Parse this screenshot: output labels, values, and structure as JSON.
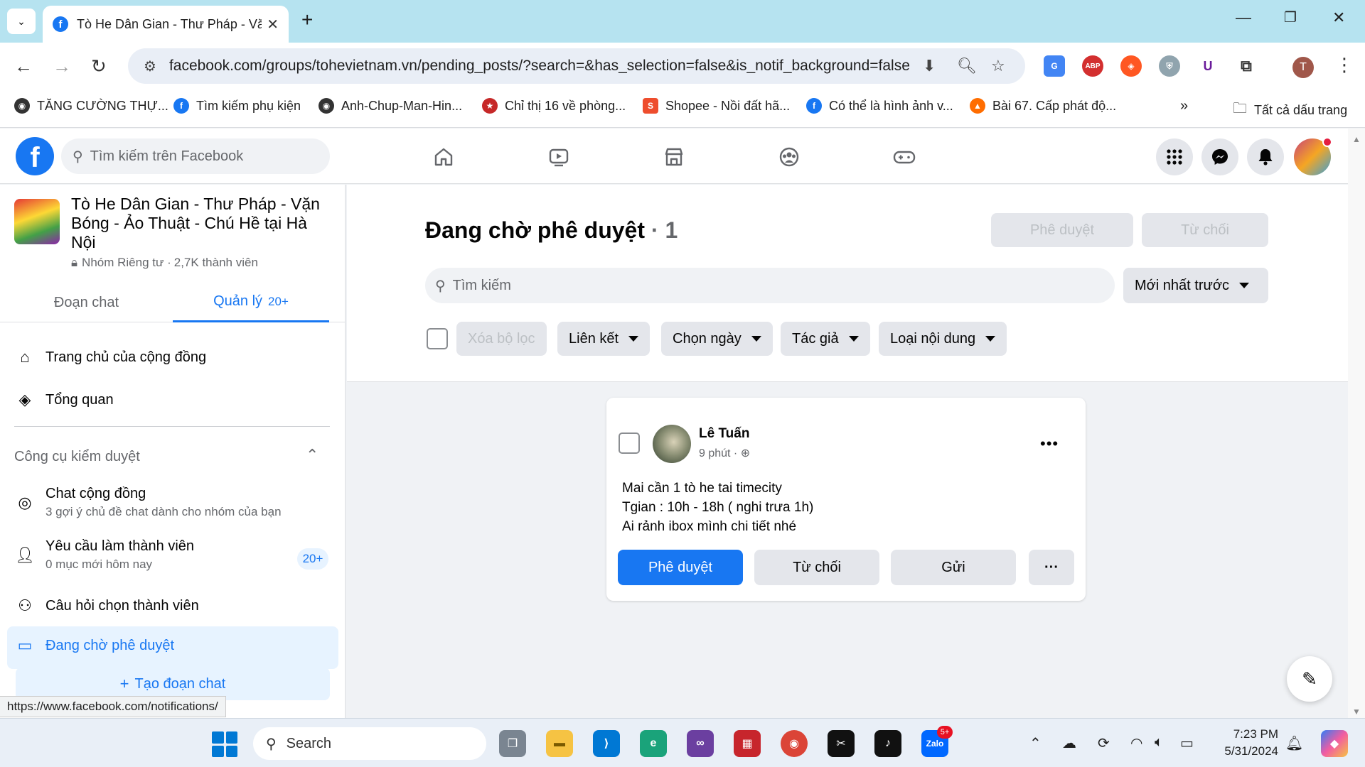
{
  "browser": {
    "tab_title": "Tò He Dân Gian - Thư Pháp - Vă",
    "url": "facebook.com/groups/tohevietnam.vn/pending_posts/?search=&has_selection=false&is_notif_background=false",
    "profile_initial": "T",
    "status_url": "https://www.facebook.com/notifications/",
    "bookmarks": [
      "TĂNG CƯỜNG THỰ...",
      "Tìm kiếm phụ kiện",
      "Anh-Chup-Man-Hin...",
      "Chỉ thị 16 về phòng...",
      "Shopee - Nồi đất hã...",
      "Có thể là hình ảnh v...",
      "Bài 67. Cấp phát độ..."
    ],
    "bookmarks_all": "Tất cả dấu trang",
    "extensions": [
      "ABP",
      "U"
    ]
  },
  "facebook": {
    "search_placeholder": "Tìm kiếm trên Facebook",
    "notification_dot_color": "#e41e3f",
    "accent": "#1877f2"
  },
  "group": {
    "name": "Tò He Dân Gian - Thư Pháp - Vặn Bóng - Ảo Thuật - Chú Hề tại Hà Nội",
    "privacy": "Nhóm Riêng tư · ",
    "members": "2,7K thành viên",
    "tabs": [
      {
        "label": "Đoạn chat",
        "count": ""
      },
      {
        "label": "Quản lý",
        "count": "20+"
      }
    ]
  },
  "sidebar": {
    "items": [
      {
        "label": "Trang chủ của cộng đồng",
        "icon": "home-icon"
      },
      {
        "label": "Tổng quan",
        "icon": "layers-icon"
      }
    ],
    "section_title": "Công cụ kiểm duyệt",
    "tools": [
      {
        "label": "Chat cộng đồng",
        "sub": "3 gợi ý chủ đề chat dành cho nhóm của bạn",
        "icon": "messenger-icon"
      },
      {
        "label": "Yêu cầu làm thành viên",
        "sub": "0 mục mới hôm nay",
        "badge": "20+",
        "icon": "person-add-icon"
      },
      {
        "label": "Câu hỏi chọn thành viên",
        "sub": "",
        "icon": "question-people-icon"
      },
      {
        "label": "Đang chờ phê duyệt",
        "sub": "",
        "icon": "pending-icon"
      }
    ],
    "create_chat": "Tạo đoạn chat"
  },
  "main": {
    "title": "Đang chờ phê duyệt",
    "count": "· 1",
    "approve_all": "Phê duyệt",
    "reject_all": "Từ chối",
    "search_placeholder": "Tìm kiếm",
    "sort": "Mới nhất trước",
    "filters": {
      "clear": "Xóa bộ lọc",
      "link": "Liên kết",
      "date": "Chọn ngày",
      "author": "Tác giả",
      "content_type": "Loại nội dung"
    }
  },
  "post": {
    "author": "Lê Tuấn",
    "time": "9 phút · ",
    "audience_icon": "globe-icon",
    "lines": [
      "Mai cần 1 tò he tai timecity",
      "Tgian : 10h - 18h ( nghi trưa 1h)",
      "Ai rảnh ibox mình chi tiết nhé"
    ],
    "approve": "Phê duyệt",
    "reject": "Từ chối",
    "send": "Gửi",
    "more": "···"
  },
  "taskbar": {
    "search_label": "Search",
    "time": "7:23 PM",
    "date": "5/31/2024",
    "zalo_badge": "5+"
  }
}
